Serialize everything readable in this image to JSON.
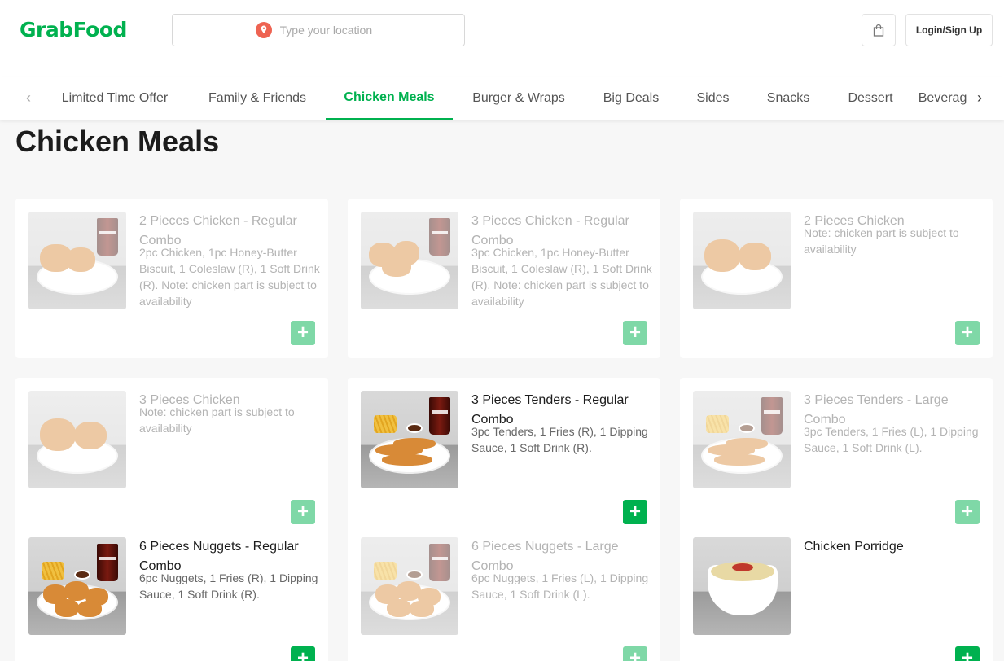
{
  "header": {
    "logo_text": "GrabFood",
    "location_placeholder": "Type your location",
    "login_label": "Login/Sign Up"
  },
  "categories": [
    {
      "label": "Limited Time Offer"
    },
    {
      "label": "Family & Friends"
    },
    {
      "label": "Chicken Meals",
      "active": true
    },
    {
      "label": "Burger & Wraps"
    },
    {
      "label": "Big Deals"
    },
    {
      "label": "Sides"
    },
    {
      "label": "Snacks"
    },
    {
      "label": "Dessert"
    },
    {
      "label": "Beverages"
    }
  ],
  "section": {
    "title": "Chicken Meals"
  },
  "items": [
    {
      "name": "2 Pieces Chicken - Regular Combo",
      "desc": "2pc Chicken, 1pc Honey-Butter Biscuit, 1 Coleslaw (R), 1 Soft Drink (R). Note: chicken part is subject to availability",
      "available": false
    },
    {
      "name": "3 Pieces Chicken - Regular Combo",
      "desc": "3pc Chicken, 1pc Honey-Butter Biscuit, 1 Coleslaw (R), 1 Soft Drink (R). Note: chicken part is subject to availability",
      "available": false
    },
    {
      "name": "2 Pieces Chicken",
      "desc": "Note: chicken part is subject to availability",
      "available": false
    },
    {
      "name": "3 Pieces Chicken",
      "desc": "Note: chicken part is subject to availability",
      "available": false
    },
    {
      "name": "3 Pieces Tenders - Regular Combo",
      "desc": "3pc Tenders, 1 Fries (R), 1 Dipping Sauce, 1 Soft Drink (R).",
      "available": true
    },
    {
      "name": "3 Pieces Tenders - Large Combo",
      "desc": "3pc Tenders, 1 Fries (L), 1 Dipping Sauce, 1 Soft Drink (L).",
      "available": false
    },
    {
      "name": "6 Pieces Nuggets - Regular Combo",
      "desc": "6pc Nuggets, 1 Fries (R), 1 Dipping Sauce, 1 Soft Drink (R).",
      "available": true
    },
    {
      "name": "6 Pieces Nuggets - Large Combo",
      "desc": "6pc Nuggets, 1 Fries (L), 1 Dipping Sauce, 1 Soft Drink (L).",
      "available": false
    },
    {
      "name": "Chicken Porridge",
      "desc": "",
      "available": true
    }
  ],
  "colors": {
    "brand": "#00b14f",
    "brand_disabled": "#7fd8a7",
    "pin": "#ee6352"
  },
  "icons": {
    "location": "location-pin-icon",
    "cart": "shopping-bag-icon",
    "add": "plus-icon",
    "prev": "chevron-left-icon",
    "next": "chevron-right-icon"
  }
}
